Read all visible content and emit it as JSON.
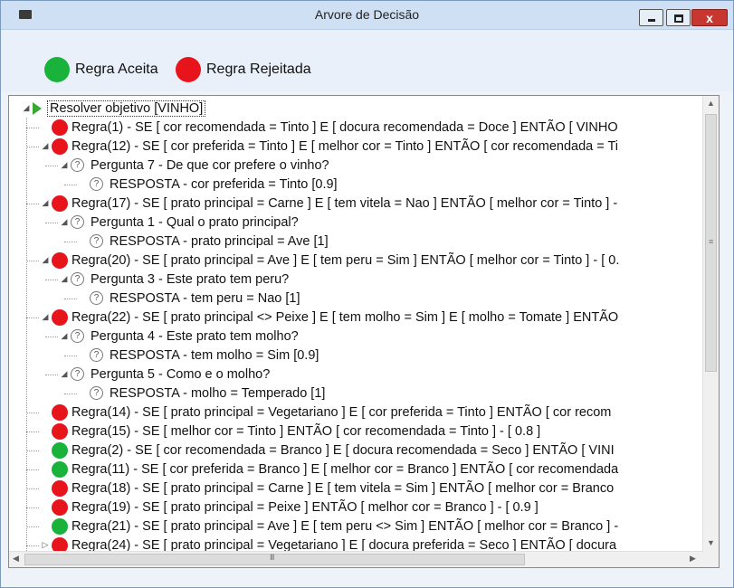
{
  "window": {
    "title": "Arvore de Decisão",
    "buttons": {
      "minimize": "–",
      "maximize": "□",
      "close": "x"
    }
  },
  "legend": {
    "accepted_label": "Regra Aceita",
    "rejected_label": "Regra Rejeitada",
    "accepted_color": "#19b23b",
    "rejected_color": "#e8141c"
  },
  "tree": {
    "rows": [
      {
        "type": "root",
        "level": 0,
        "expander": "open",
        "text": "Resolver objetivo [VINHO]"
      },
      {
        "type": "rule",
        "status": "rejected",
        "level": 1,
        "expander": "none",
        "text": "Regra(1) - SE [ cor recomendada = Tinto ] E [ docura recomendada = Doce ]  ENTÃO [ VINHO"
      },
      {
        "type": "rule",
        "status": "rejected",
        "level": 1,
        "expander": "open",
        "text": "Regra(12) - SE [ cor preferida = Tinto ] E [ melhor cor = Tinto ]  ENTÃO [ cor recomendada = Ti"
      },
      {
        "type": "question",
        "level": 2,
        "expander": "open",
        "text": "Pergunta 7 - De que cor prefere o vinho?"
      },
      {
        "type": "answer",
        "level": 3,
        "expander": "none",
        "text": "RESPOSTA - cor preferida = Tinto [0.9]"
      },
      {
        "type": "rule",
        "status": "rejected",
        "level": 1,
        "expander": "open",
        "text": "Regra(17) - SE [ prato principal = Carne ] E [ tem vitela = Nao ]  ENTÃO [ melhor cor = Tinto ] -"
      },
      {
        "type": "question",
        "level": 2,
        "expander": "open",
        "text": "Pergunta 1 - Qual o prato principal?"
      },
      {
        "type": "answer",
        "level": 3,
        "expander": "none",
        "text": "RESPOSTA - prato principal = Ave [1]"
      },
      {
        "type": "rule",
        "status": "rejected",
        "level": 1,
        "expander": "open",
        "text": "Regra(20) - SE [ prato principal = Ave ] E [ tem peru = Sim ]  ENTÃO [ melhor cor = Tinto ] - [ 0."
      },
      {
        "type": "question",
        "level": 2,
        "expander": "open",
        "text": "Pergunta 3 - Este prato tem peru?"
      },
      {
        "type": "answer",
        "level": 3,
        "expander": "none",
        "text": "RESPOSTA - tem peru = Nao [1]"
      },
      {
        "type": "rule",
        "status": "rejected",
        "level": 1,
        "expander": "open",
        "text": "Regra(22) - SE [ prato principal <> Peixe ] E [ tem molho = Sim ] E [ molho = Tomate ]  ENTÃO"
      },
      {
        "type": "question",
        "level": 2,
        "expander": "open",
        "text": "Pergunta 4 - Este prato tem molho?"
      },
      {
        "type": "answer",
        "level": 3,
        "expander": "none",
        "text": "RESPOSTA - tem molho = Sim [0.9]"
      },
      {
        "type": "question",
        "level": 2,
        "expander": "open",
        "text": "Pergunta 5 - Como e o molho?"
      },
      {
        "type": "answer",
        "level": 3,
        "expander": "none",
        "text": "RESPOSTA - molho = Temperado [1]"
      },
      {
        "type": "rule",
        "status": "rejected",
        "level": 1,
        "expander": "none",
        "text": "Regra(14) - SE [ prato principal = Vegetariano ] E [ cor preferida = Tinto ]  ENTÃO [ cor recom"
      },
      {
        "type": "rule",
        "status": "rejected",
        "level": 1,
        "expander": "none",
        "text": "Regra(15) - SE [ melhor cor = Tinto ]  ENTÃO [ cor recomendada = Tinto ] - [ 0.8 ]"
      },
      {
        "type": "rule",
        "status": "accepted",
        "level": 1,
        "expander": "none",
        "text": "Regra(2) - SE [ cor recomendada = Branco ] E [ docura recomendada = Seco ]  ENTÃO [ VINI"
      },
      {
        "type": "rule",
        "status": "accepted",
        "level": 1,
        "expander": "none",
        "text": "Regra(11) - SE [ cor preferida = Branco ] E [ melhor cor = Branco ]  ENTÃO [ cor recomendada"
      },
      {
        "type": "rule",
        "status": "rejected",
        "level": 1,
        "expander": "none",
        "text": "Regra(18) - SE [ prato principal = Carne ] E [ tem vitela = Sim ]  ENTÃO [ melhor cor = Branco"
      },
      {
        "type": "rule",
        "status": "rejected",
        "level": 1,
        "expander": "none",
        "text": "Regra(19) - SE [ prato principal = Peixe ]  ENTÃO [ melhor cor = Branco ] - [ 0.9 ]"
      },
      {
        "type": "rule",
        "status": "accepted",
        "level": 1,
        "expander": "none",
        "text": "Regra(21) - SE [ prato principal = Ave ] E [ tem peru <> Sim ]  ENTÃO [ melhor cor = Branco ] -"
      },
      {
        "type": "rule",
        "status": "rejected",
        "level": 1,
        "expander": "closed",
        "text": "Regra(24) - SE [ prato principal = Vegetariano ] E [ docura preferida = Seco ]  ENTÃO [ docura"
      }
    ]
  },
  "scrollbars": {
    "up": "▲",
    "down": "▼",
    "left": "◀",
    "right": "▶",
    "grip_v": "≡",
    "grip_h": "III"
  }
}
